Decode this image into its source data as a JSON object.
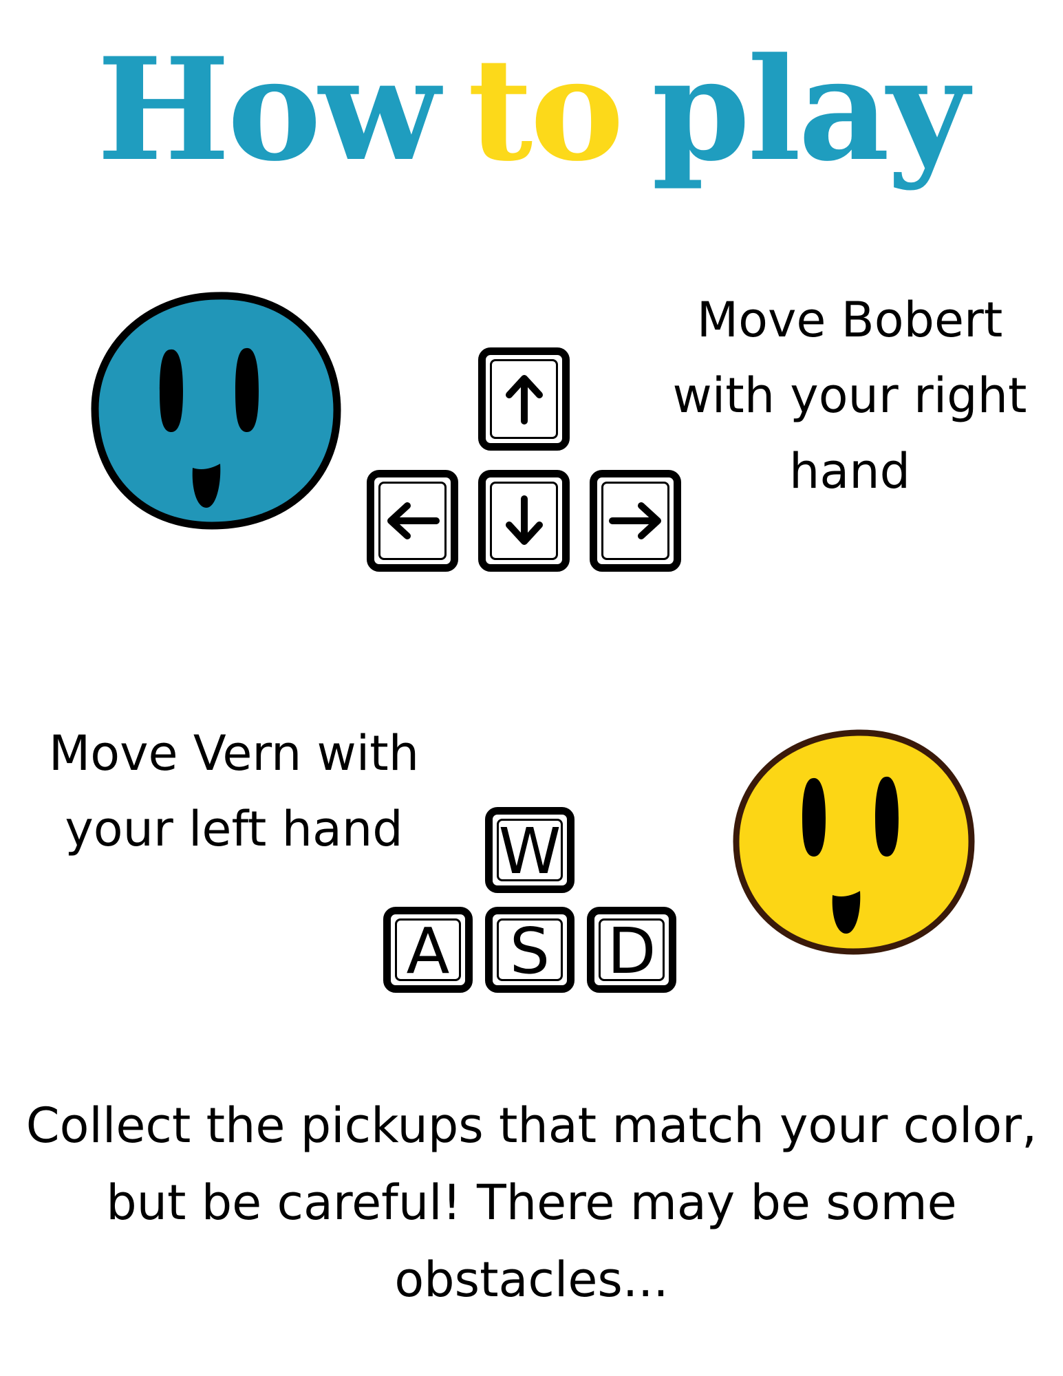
{
  "title": {
    "word1": "How",
    "word2": "to",
    "word3": "play",
    "colors": {
      "blue": "#1f9dbf",
      "yellow": "#fcd91a"
    }
  },
  "bobert": {
    "name": "Bobert",
    "color": "#2196b8",
    "instructions": [
      "Move Bobert",
      "with your right",
      "hand"
    ],
    "keys": {
      "up": "arrow-up-icon",
      "left": "arrow-left-icon",
      "down": "arrow-down-icon",
      "right": "arrow-right-icon"
    }
  },
  "vern": {
    "name": "Vern",
    "color": "#fcd615",
    "instructions": [
      "Move Vern with",
      "your left hand"
    ],
    "keys": {
      "up": "W",
      "left": "A",
      "down": "S",
      "right": "D"
    }
  },
  "footer": {
    "lines": [
      "Collect the pickups that match your color,",
      "but be careful! There may be some",
      "obstacles..."
    ]
  }
}
